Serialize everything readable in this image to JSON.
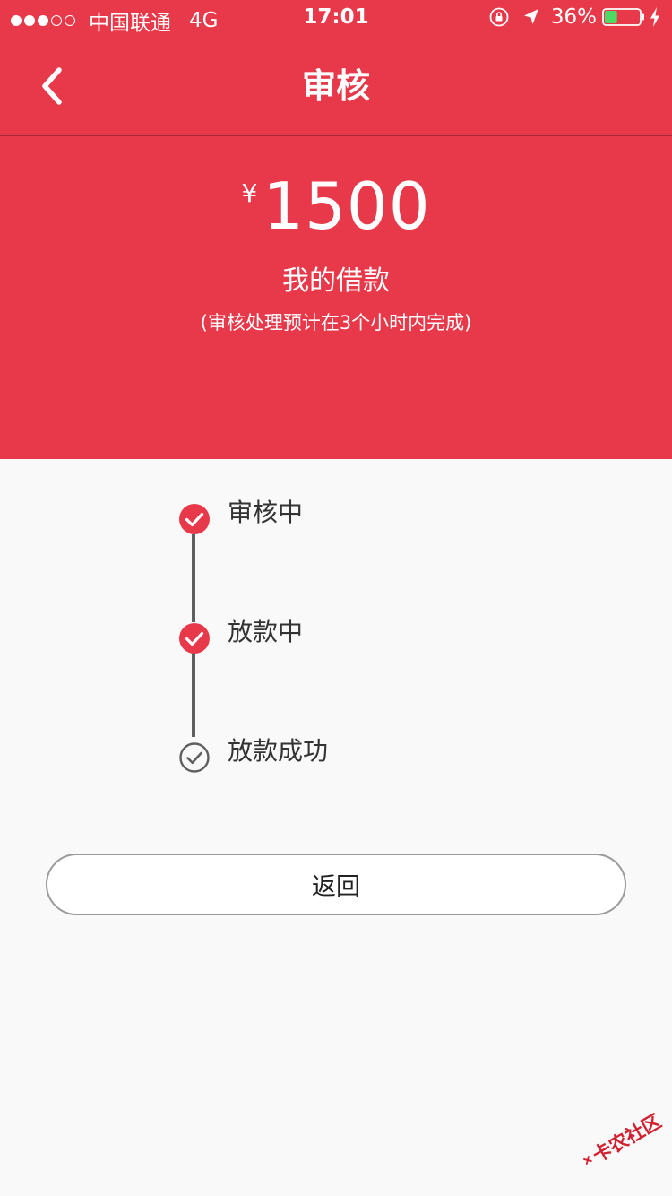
{
  "status_bar": {
    "carrier": "中国联通",
    "network": "4G",
    "time": "17:01",
    "battery_percent": "36%",
    "battery_level": 0.36
  },
  "nav": {
    "title": "审核"
  },
  "loan": {
    "currency_symbol": "¥",
    "amount": "1500",
    "label": "我的借款",
    "note": "(审核处理预计在3个小时内完成)"
  },
  "steps": [
    {
      "label": "审核中",
      "status": "done"
    },
    {
      "label": "放款中",
      "status": "done"
    },
    {
      "label": "放款成功",
      "status": "pending"
    }
  ],
  "actions": {
    "return_label": "返回"
  },
  "watermark": {
    "text": "卡农社区"
  },
  "colors": {
    "accent": "#e8394a",
    "background": "#f9f9f9",
    "pending": "#5f5f5f"
  },
  "icons": {
    "back": "chevron-left-icon",
    "step_done": "check-circle-filled-icon",
    "step_pending": "check-circle-outline-icon"
  }
}
